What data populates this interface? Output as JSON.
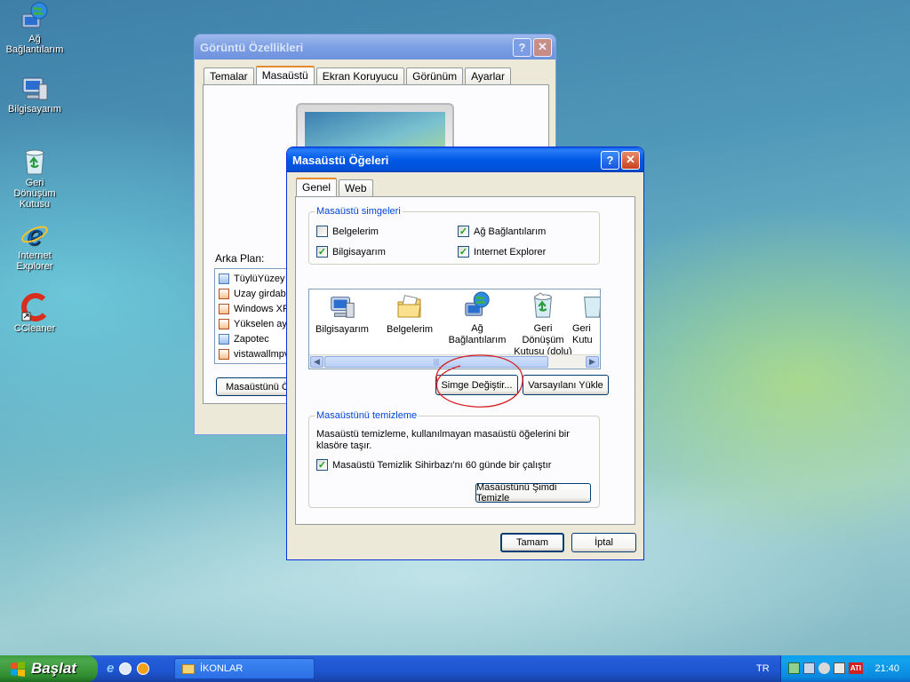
{
  "desktop": {
    "icons": [
      {
        "label": "Ağ Bağlantılarım",
        "icon": "network-globe-icon"
      },
      {
        "label": "Bilgisayarım",
        "icon": "computer-icon"
      },
      {
        "label": "Geri Dönüşüm Kutusu",
        "icon": "recycle-bin-icon"
      },
      {
        "label": "Internet Explorer",
        "icon": "ie-icon"
      },
      {
        "label": "CCleaner",
        "icon": "ccleaner-icon"
      }
    ]
  },
  "display_props": {
    "title": "Görüntü Özellikleri",
    "tabs": [
      "Temalar",
      "Masaüstü",
      "Ekran Koruyucu",
      "Görünüm",
      "Ayarlar"
    ],
    "selected_tab": "Masaüstü",
    "background_label": "Arka Plan:",
    "backgrounds": [
      "TüylüYüzey",
      "Uzay girdabı",
      "Windows XP",
      "Yükselen ay",
      "Zapotec",
      "vistawallmpv"
    ],
    "customize_button": "Masaüstünü Ö"
  },
  "desktop_items": {
    "title": "Masaüstü Öğeleri",
    "tabs": [
      "Genel",
      "Web"
    ],
    "selected_tab": "Genel",
    "icons_group": {
      "label": "Masaüstü simgeleri",
      "checkboxes": [
        {
          "label": "Belgelerim",
          "checked": false
        },
        {
          "label": "Ağ Bağlantılarım",
          "checked": true
        },
        {
          "label": "Bilgisayarım",
          "checked": true
        },
        {
          "label": "Internet Explorer",
          "checked": true
        }
      ]
    },
    "icon_list": [
      {
        "label": "Bilgisayarım",
        "icon": "computer-icon"
      },
      {
        "label": "Belgelerim",
        "icon": "folder-icon"
      },
      {
        "label": "Ağ Bağlantılarım",
        "icon": "network-globe-icon"
      },
      {
        "label": "Geri Dönüşüm Kutusu (dolu)",
        "icon": "recycle-bin-full-icon"
      },
      {
        "label": "Geri Kutu",
        "icon": "recycle-bin-empty-icon"
      }
    ],
    "change_icon_button": "Simge Değiştir...",
    "restore_default_button": "Varsayılanı Yükle",
    "cleanup_group": {
      "label": "Masaüstünü temizleme",
      "description": "Masaüstü temizleme, kullanılmayan masaüstü öğelerini bir klasöre taşır.",
      "checkbox_label": "Masaüstü Temizlik Sihirbazı'nı 60 günde bir çalıştır",
      "checkbox_checked": true,
      "cleanup_button": "Masaüstünü Şimdi Temizle"
    },
    "ok_button": "Tamam",
    "cancel_button": "İptal"
  },
  "taskbar": {
    "start_label": "Başlat",
    "task_label": "İKONLAR",
    "language": "TR",
    "clock": "21:40"
  },
  "colors": {
    "title_active": "#0058e6",
    "annotation_circle": "#d62020"
  }
}
